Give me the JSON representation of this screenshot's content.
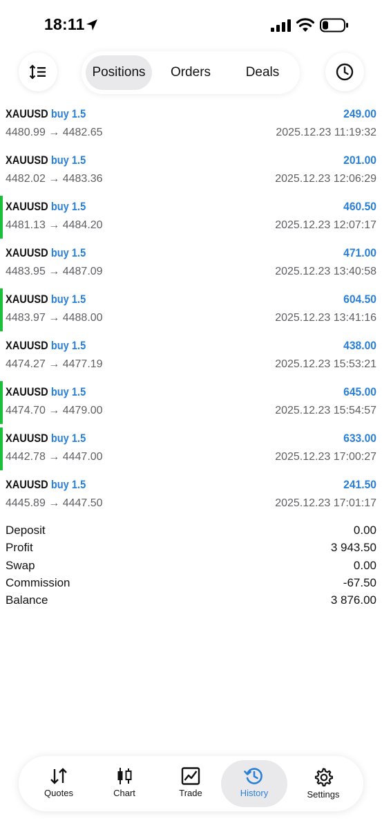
{
  "status_bar": {
    "time": "18:11",
    "icons": [
      "location-arrow-icon",
      "cellular-signal-icon",
      "wifi-icon",
      "battery-low-icon"
    ]
  },
  "toolbar": {
    "sort_icon": "sort-icon",
    "clock_icon": "clock-icon",
    "tabs": [
      {
        "label": "Positions",
        "active": true
      },
      {
        "label": "Orders",
        "active": false
      },
      {
        "label": "Deals",
        "active": false
      }
    ]
  },
  "colors": {
    "accent": "#2a7fd6",
    "marker": "#1bbf3a",
    "secondary_text": "#5f5f63"
  },
  "deals": [
    {
      "symbol": "XAUUSD",
      "side": "buy 1.5",
      "prices": "4480.99 → 4482.65",
      "profit": "249.00",
      "time": "2025.12.23 11:19:32",
      "marked": false
    },
    {
      "symbol": "XAUUSD",
      "side": "buy 1.5",
      "prices": "4482.02 → 4483.36",
      "profit": "201.00",
      "time": "2025.12.23 12:06:29",
      "marked": false
    },
    {
      "symbol": "XAUUSD",
      "side": "buy 1.5",
      "prices": "4481.13 → 4484.20",
      "profit": "460.50",
      "time": "2025.12.23 12:07:17",
      "marked": true
    },
    {
      "symbol": "XAUUSD",
      "side": "buy 1.5",
      "prices": "4483.95 → 4487.09",
      "profit": "471.00",
      "time": "2025.12.23 13:40:58",
      "marked": false
    },
    {
      "symbol": "XAUUSD",
      "side": "buy 1.5",
      "prices": "4483.97 → 4488.00",
      "profit": "604.50",
      "time": "2025.12.23 13:41:16",
      "marked": true
    },
    {
      "symbol": "XAUUSD",
      "side": "buy 1.5",
      "prices": "4474.27 → 4477.19",
      "profit": "438.00",
      "time": "2025.12.23 15:53:21",
      "marked": false
    },
    {
      "symbol": "XAUUSD",
      "side": "buy 1.5",
      "prices": "4474.70 → 4479.00",
      "profit": "645.00",
      "time": "2025.12.23 15:54:57",
      "marked": true
    },
    {
      "symbol": "XAUUSD",
      "side": "buy 1.5",
      "prices": "4442.78 → 4447.00",
      "profit": "633.00",
      "time": "2025.12.23 17:00:27",
      "marked": true
    },
    {
      "symbol": "XAUUSD",
      "side": "buy 1.5",
      "prices": "4445.89 → 4447.50",
      "profit": "241.50",
      "time": "2025.12.23 17:01:17",
      "marked": false
    }
  ],
  "summary": [
    {
      "label": "Deposit",
      "value": "0.00"
    },
    {
      "label": "Profit",
      "value": "3 943.50"
    },
    {
      "label": "Swap",
      "value": "0.00"
    },
    {
      "label": "Commission",
      "value": "-67.50"
    },
    {
      "label": "Balance",
      "value": "3 876.00"
    }
  ],
  "bottom_nav": [
    {
      "label": "Quotes",
      "icon": "quotes-arrows-icon",
      "active": false
    },
    {
      "label": "Chart",
      "icon": "candlestick-icon",
      "active": false
    },
    {
      "label": "Trade",
      "icon": "trade-chart-icon",
      "active": false
    },
    {
      "label": "History",
      "icon": "history-icon",
      "active": true
    },
    {
      "label": "Settings",
      "icon": "gear-icon",
      "active": false
    }
  ]
}
